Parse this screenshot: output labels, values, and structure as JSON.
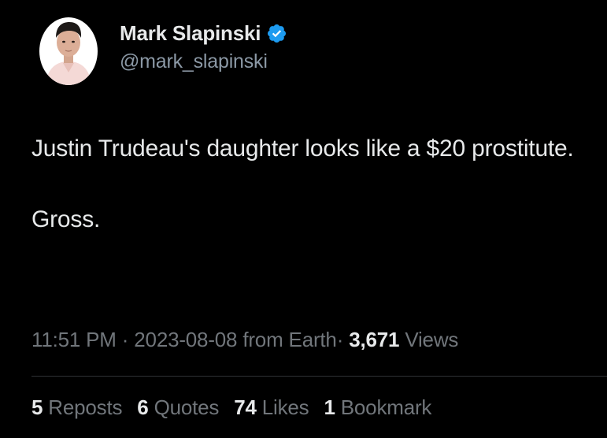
{
  "colors": {
    "background": "#000000",
    "primary_text": "#e7e9ea",
    "secondary_text": "#71767b",
    "verified_badge": "#1d9bf0",
    "divider": "#2f3336"
  },
  "author": {
    "display_name": "Mark Slapinski",
    "handle": "@mark_slapinski",
    "avatar_icon": "profile-photo",
    "verified_icon": "verified-badge-icon"
  },
  "tweet": {
    "paragraphs": [
      "Justin Trudeau's daughter looks like a $20 prostitute.",
      "Gross."
    ]
  },
  "meta": {
    "time": "11:51 PM",
    "separator": "·",
    "date": "2023-08-08",
    "source": "from Earth",
    "views_count": "3,671",
    "views_label": "Views"
  },
  "stats": {
    "reposts_count": "5",
    "reposts_label": "Reposts",
    "quotes_count": "6",
    "quotes_label": "Quotes",
    "likes_count": "74",
    "likes_label": "Likes",
    "bookmarks_count": "1",
    "bookmarks_label": "Bookmark"
  }
}
